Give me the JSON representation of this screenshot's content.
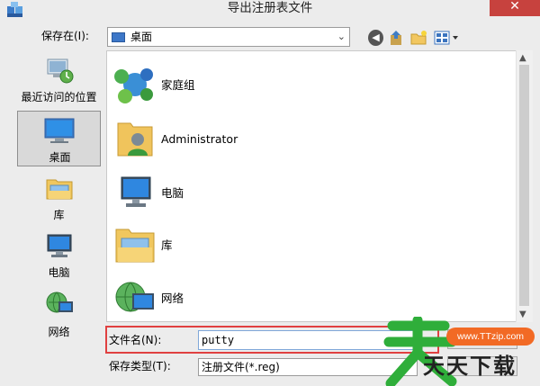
{
  "window": {
    "title": "导出注册表文件",
    "close": "✕"
  },
  "toolbar": {
    "save_in_label": "保存在(I):",
    "location": "桌面",
    "icons": [
      "back-icon",
      "up-folder-icon",
      "new-folder-icon",
      "views-menu-icon"
    ]
  },
  "places": [
    {
      "label": "最近访问的位置",
      "icon": "recent-places-icon",
      "selected": false
    },
    {
      "label": "桌面",
      "icon": "desktop-icon",
      "selected": true
    },
    {
      "label": "库",
      "icon": "libraries-icon",
      "selected": false
    },
    {
      "label": "电脑",
      "icon": "computer-icon",
      "selected": false
    },
    {
      "label": "网络",
      "icon": "network-icon",
      "selected": false
    }
  ],
  "files": [
    {
      "label": "家庭组",
      "icon": "homegroup-icon"
    },
    {
      "label": "Administrator",
      "icon": "user-folder-icon"
    },
    {
      "label": "电脑",
      "icon": "computer-icon"
    },
    {
      "label": "库",
      "icon": "libraries-icon"
    },
    {
      "label": "网络",
      "icon": "network-icon"
    }
  ],
  "form": {
    "file_name_label": "文件名(N):",
    "file_name_value": "putty",
    "file_type_label": "保存类型(T):",
    "file_type_value": "注册文件(*.reg)"
  },
  "watermark": {
    "badge": "www.TTzip.com",
    "text": "天天下载"
  },
  "colors": {
    "close_red": "#c7423e",
    "highlight_red": "#e04040",
    "watermark_orange": "#f26a25"
  }
}
